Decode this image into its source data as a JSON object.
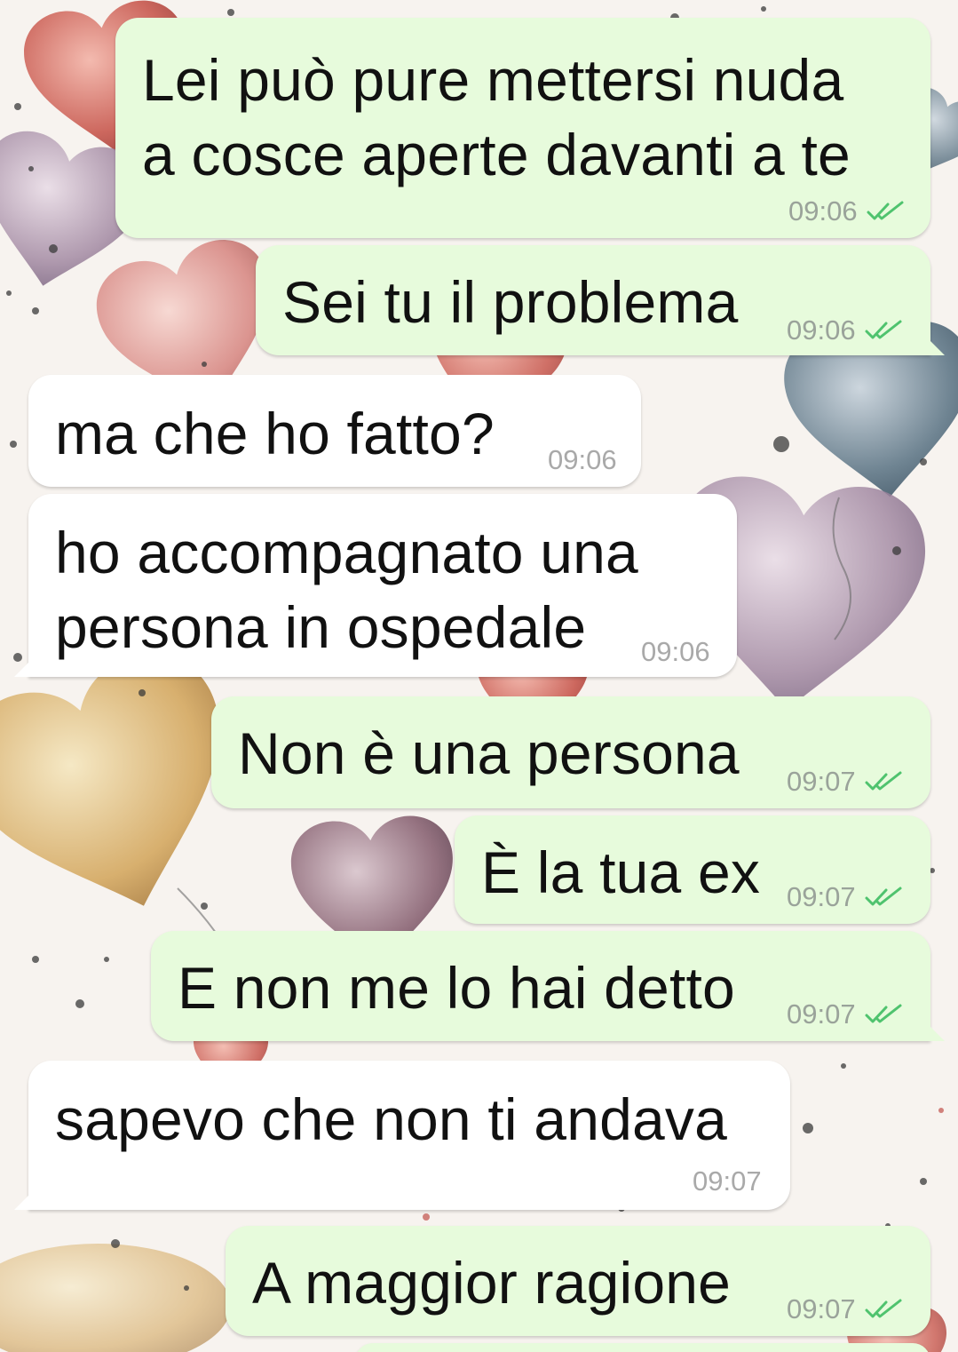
{
  "colors": {
    "outgoing_bubble": "#e7fbdc",
    "incoming_bubble": "#ffffff",
    "read_ticks": "#4fc36e",
    "timestamp": "#9aa39a"
  },
  "icons": {
    "read_receipt": "double-check-icon",
    "wallpaper": "watercolor-heart-balloons"
  },
  "messages": [
    {
      "direction": "out",
      "lines": [
        "Lei può pure mettersi nuda",
        "a cosce aperte davanti a te"
      ],
      "time": "09:06",
      "status": "read"
    },
    {
      "direction": "out",
      "lines": [
        "Sei tu il problema"
      ],
      "time": "09:06",
      "status": "read"
    },
    {
      "direction": "in",
      "lines": [
        "ma che ho fatto?"
      ],
      "time": "09:06"
    },
    {
      "direction": "in",
      "lines": [
        "ho accompagnato una",
        "persona in ospedale"
      ],
      "time": "09:06"
    },
    {
      "direction": "out",
      "lines": [
        "Non è una persona"
      ],
      "time": "09:07",
      "status": "read"
    },
    {
      "direction": "out",
      "lines": [
        "È la tua ex"
      ],
      "time": "09:07",
      "status": "read"
    },
    {
      "direction": "out",
      "lines": [
        "E non me lo hai detto"
      ],
      "time": "09:07",
      "status": "read"
    },
    {
      "direction": "in",
      "lines": [
        "sapevo che non ti andava"
      ],
      "time": "09:07"
    },
    {
      "direction": "out",
      "lines": [
        "A maggior ragione"
      ],
      "time": "09:07",
      "status": "read"
    }
  ]
}
